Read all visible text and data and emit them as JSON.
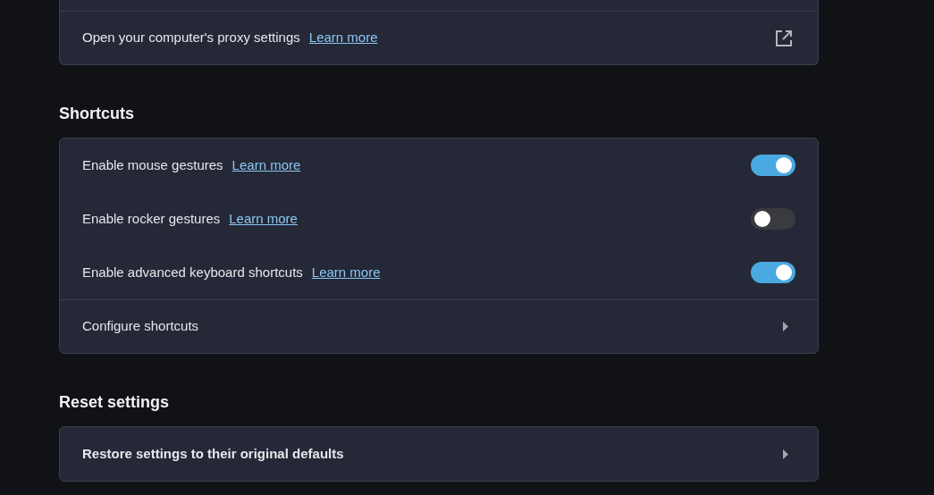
{
  "sections": [
    {
      "rows": [
        {
          "kind": "external",
          "label": "Open your computer's proxy settings",
          "link": "Learn more",
          "bold": false
        }
      ]
    },
    {
      "title": "Shortcuts",
      "rows": [
        {
          "kind": "toggle",
          "label": "Enable mouse gestures",
          "link": "Learn more",
          "on": true,
          "bold": false
        },
        {
          "kind": "toggle",
          "label": "Enable rocker gestures",
          "link": "Learn more",
          "on": false,
          "bold": false
        },
        {
          "kind": "toggle",
          "label": "Enable advanced keyboard shortcuts",
          "link": "Learn more",
          "on": true,
          "bold": false
        },
        {
          "kind": "nav",
          "label": "Configure shortcuts",
          "bold": false
        }
      ]
    },
    {
      "title": "Reset settings",
      "rows": [
        {
          "kind": "nav",
          "label": "Restore settings to their original defaults",
          "bold": true
        }
      ]
    }
  ]
}
